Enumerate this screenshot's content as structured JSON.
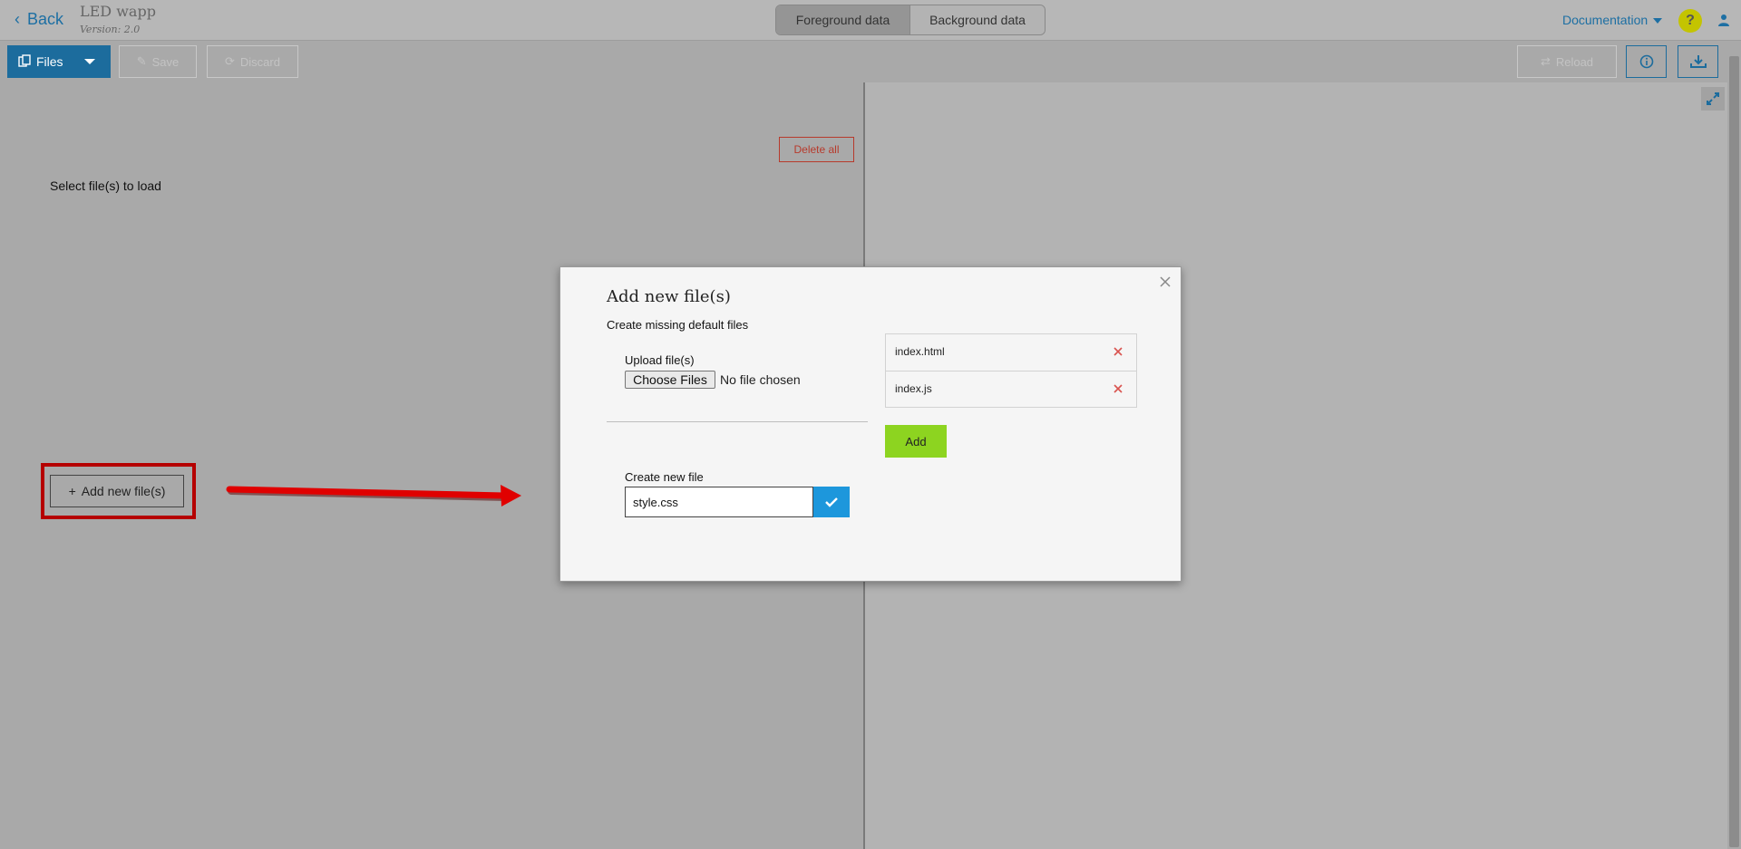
{
  "header": {
    "back_label": "Back",
    "app_name": "LED wapp",
    "app_version": "Version: 2.0",
    "tabs": [
      {
        "label": "Foreground data",
        "active": true
      },
      {
        "label": "Background data",
        "active": false
      }
    ],
    "documentation_label": "Documentation",
    "help_label": "?"
  },
  "toolbar": {
    "files_label": "Files",
    "save_label": "Save",
    "discard_label": "Discard",
    "reload_label": "Reload",
    "info_icon": "info-icon",
    "download_icon": "download-icon"
  },
  "left_panel": {
    "delete_all_label": "Delete all",
    "select_files_text": "Select file(s) to load",
    "add_new_label": "Add new file(s)"
  },
  "modal": {
    "title": "Add new file(s)",
    "subtitle": "Create missing default files",
    "upload_label": "Upload file(s)",
    "choose_files_label": "Choose Files",
    "no_file_text": "No file chosen",
    "create_label": "Create new file",
    "new_file_value": "style.css",
    "files": [
      {
        "name": "index.html"
      },
      {
        "name": "index.js"
      }
    ],
    "add_label": "Add"
  },
  "colors": {
    "accent_blue": "#1c6c9d",
    "confirm_blue": "#1d97dc",
    "add_green": "#8dd420",
    "danger_red": "#b73a2c",
    "annotation_red": "#e00000"
  }
}
